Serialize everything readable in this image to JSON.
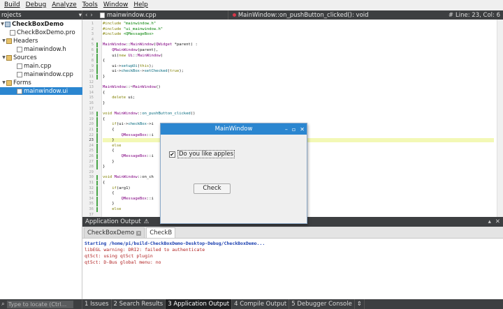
{
  "menubar": [
    "Build",
    "Debug",
    "Analyze",
    "Tools",
    "Window",
    "Help"
  ],
  "topbar": {
    "projects_label": "rojects",
    "file_tab": "mainwindow.cpp",
    "function_tab": "MainWindow::on_pushButton_clicked(): void",
    "line_col": "Line: 23, Col: 6"
  },
  "tree": [
    {
      "label": "CheckBoxDemo",
      "icon": "project-icon",
      "bold": true
    },
    {
      "label": "CheckBoxDemo.pro",
      "icon": "file-icon"
    },
    {
      "label": "Headers",
      "icon": "folder-icon"
    },
    {
      "label": "mainwindow.h",
      "icon": "file-icon"
    },
    {
      "label": "Sources",
      "icon": "folder-icon"
    },
    {
      "label": "main.cpp",
      "icon": "file-icon"
    },
    {
      "label": "mainwindow.cpp",
      "icon": "file-icon"
    },
    {
      "label": "Forms",
      "icon": "folder-icon"
    },
    {
      "label": "mainwindow.ui",
      "icon": "file-icon",
      "selected": true
    }
  ],
  "editor": {
    "line_numbers": [
      "1",
      "2",
      "3",
      "4",
      "5",
      "6",
      "7",
      "8",
      "9",
      "10",
      "11",
      "12",
      "13",
      "14",
      "15",
      "16",
      "17",
      "18",
      "19",
      "20",
      "21",
      "22",
      "23",
      "24",
      "25",
      "26",
      "27",
      "28",
      "29",
      "30",
      "31",
      "32",
      "33",
      "34",
      "35",
      "36",
      "37"
    ],
    "lines": [
      "#include \"mainwindow.h\"",
      "#include \"ui_mainwindow.h\"",
      "#include <QMessageBox>",
      "",
      "MainWindow::MainWindow(QWidget *parent) :",
      "    QMainWindow(parent),",
      "    ui(new Ui::MainWindow)",
      "{",
      "    ui->setupUi(this);",
      "    ui->checkBox->setChecked(true);",
      "}",
      "",
      "MainWindow::~MainWindow()",
      "{",
      "    delete ui;",
      "}",
      "",
      "void MainWindow::on_pushButton_clicked()",
      "{",
      "    if(ui->checkBox->i",
      "    {",
      "        QMessageBox::i",
      "    }",
      "    else",
      "    {",
      "        QMessageBox::i",
      "    }",
      "}",
      "",
      "void MainWindow::on_ch",
      "{",
      "    if(arg1)",
      "    {",
      "        QMessageBox::i",
      "    }",
      "    else"
    ]
  },
  "output": {
    "title": "Application Output",
    "tabs": [
      "CheckBoxDemo",
      "CheckB"
    ],
    "lines": [
      "Starting /home/pi/build-CheckBoxDemo-Desktop-Debug/CheckBoxDemo...",
      "libEGL warning: DRI2: failed to authenticate",
      "qt5ct: using qt5ct plugin",
      "qt5ct: D-Bus global menu: no"
    ]
  },
  "statusbar": {
    "locate_placeholder": "Type to locate (Ctrl...",
    "items": [
      "1 Issues",
      "2 Search Results",
      "3 Application Output",
      "4 Compile Output",
      "5 Debugger Console"
    ]
  },
  "dialog": {
    "title": "MainWindow",
    "checkbox_label": "Do you like apples",
    "checkbox_checked": true,
    "button_label": "Check"
  },
  "colors": {
    "accent": "#2b86d0",
    "dark_bar": "#3d3f41"
  }
}
